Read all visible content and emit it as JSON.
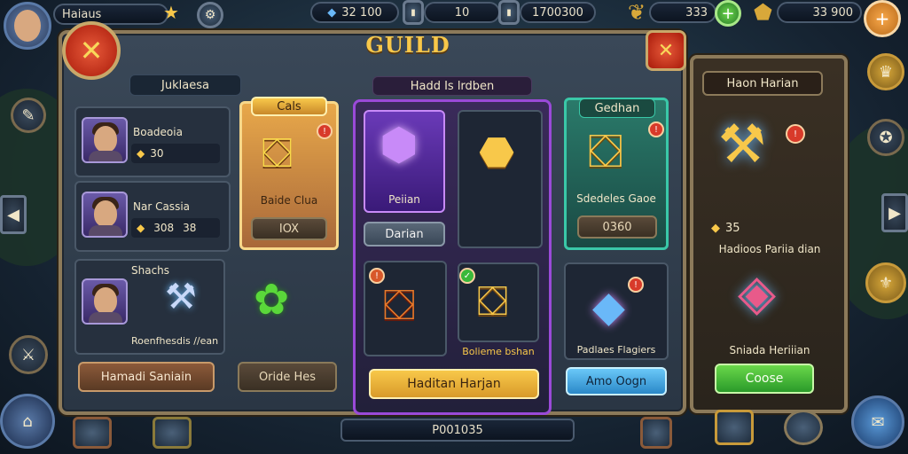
{
  "topbar": {
    "player_name": "Haiaus",
    "stat_center_left": "32 100",
    "stat_center_mid": "10",
    "stat_center_right": "1700300",
    "gold_value": "333",
    "gems_value": "33 900"
  },
  "guild": {
    "title": "GUILD",
    "left_header": "Juklaesa",
    "center_header": "Hadd Is lrdben",
    "right_header": "Haon Harian"
  },
  "members": [
    {
      "name": "Boadeoia",
      "value": "30"
    },
    {
      "name": "Nar Cassia",
      "value": "308",
      "value2": "38"
    },
    {
      "name": "Shachs",
      "subtext": "Roenfhesdis //ean"
    }
  ],
  "cards": {
    "cals_tag": "Cals",
    "cals_name": "Baide Clua",
    "cals_button": "IOX",
    "purple_name": "Peiian",
    "purple_button": "Darian",
    "gedhan_tag": "Gedhan",
    "gedhan_name": "Sdedeles Gaoe",
    "gedhan_button": "0360",
    "gold_chest_name": "Bolieme bshan",
    "blue_crystal_name": "Padlaes Flagiers",
    "blue_button": "Amo Oogn",
    "right_price": "35",
    "right_name": "Hadioos Pariia dian",
    "right_gem_name": "Sniada Heriiian",
    "right_button": "Coose"
  },
  "bottom_buttons": {
    "left": "Hamadi Saniain",
    "mid": "Oride Hes",
    "center": "Haditan Harjan"
  },
  "footer": {
    "value": "P001035"
  },
  "colors": {
    "frame": "#8c7a5a",
    "gold": "#f8c84a",
    "purple": "#9a4ad8",
    "teal": "#3ac8a8",
    "close_red": "#c83a1a"
  }
}
